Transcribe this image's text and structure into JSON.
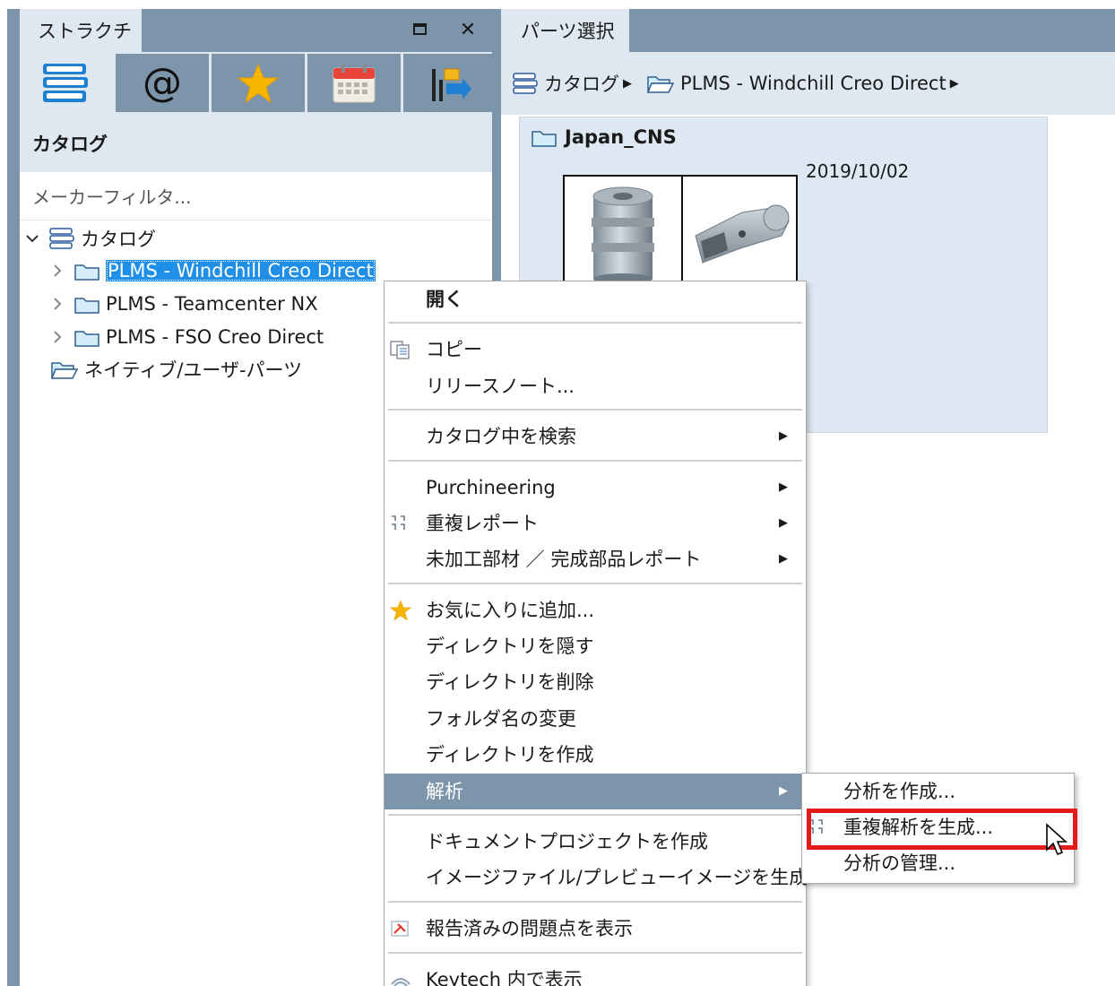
{
  "left_panel": {
    "tab_label": "ストラクチャ",
    "maximize_glyph": "☐",
    "close_glyph": "✕",
    "toolbar_icons": [
      "catalog-icon",
      "at-sign-icon",
      "star-icon",
      "calendar-icon",
      "import-icon"
    ],
    "at_glyph": "@",
    "section_title": "カタログ",
    "filter_placeholder": "メーカーフィルタ...",
    "tree": {
      "root_label": "カタログ",
      "items": [
        {
          "label": "PLMS - Windchill Creo Direct",
          "selected": true
        },
        {
          "label": "PLMS - Teamcenter NX",
          "selected": false
        },
        {
          "label": "PLMS - FSO Creo Direct",
          "selected": false
        }
      ],
      "native_label": "ネイティブ/ユーザ-パーツ"
    }
  },
  "right_panel": {
    "tab_label": "パーツ選択",
    "breadcrumb": [
      "カタログ",
      "PLMS - Windchill Creo Direct"
    ],
    "card": {
      "title": "Japan_CNS",
      "date": "2019/10/02"
    }
  },
  "context_menu": {
    "open": "開く",
    "copy": "コピー",
    "release_notes": "リリースノート...",
    "search_in_catalog": "カタログ中を検索",
    "purchineering": "Purchineering",
    "duplicate_report": "重複レポート",
    "raw_material_report": "未加工部材 ／ 完成部品レポート",
    "add_favorite": "お気に入りに追加...",
    "hide_directory": "ディレクトリを隠す",
    "delete_directory": "ディレクトリを削除",
    "rename_folder": "フォルダ名の変更",
    "create_directory": "ディレクトリを作成",
    "analysis": "解析",
    "create_document_project": "ドキュメントプロジェクトを作成",
    "generate_image_files": "イメージファイル/プレビューイメージを生成",
    "show_reported_issues": "報告済みの問題点を表示",
    "show_in_keytech": "Keytech 内で表示"
  },
  "submenu": {
    "create_analysis": "分析を作成...",
    "generate_duplicate_analysis": "重複解析を生成...",
    "manage_analysis": "分析の管理..."
  },
  "colors": {
    "panel_header": "#7d95aa",
    "panel_bg": "#dfe8f1",
    "selection": "#1f8fe8",
    "menu_hover": "#7d95aa",
    "highlight_border": "#e41b1b"
  }
}
